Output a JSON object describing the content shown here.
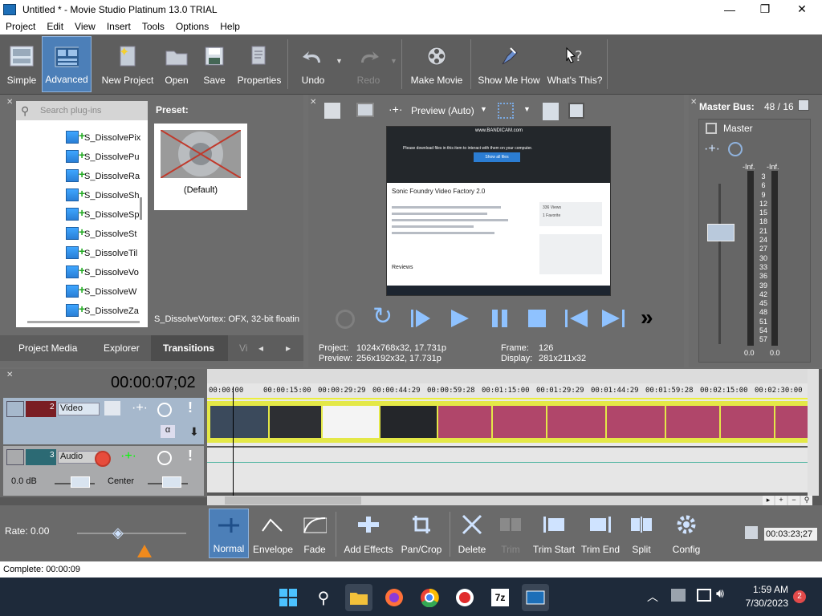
{
  "window": {
    "title": "Untitled * - Movie Studio Platinum 13.0 TRIAL",
    "minimize": "—",
    "maximize": "❐",
    "close": "✕"
  },
  "menu": [
    "Project",
    "Edit",
    "View",
    "Insert",
    "Tools",
    "Options",
    "Help"
  ],
  "toolbar": {
    "simple": "Simple",
    "advanced": "Advanced",
    "new_project": "New Project",
    "open": "Open",
    "save": "Save",
    "properties": "Properties",
    "undo": "Undo",
    "redo": "Redo",
    "make_movie": "Make Movie",
    "show_me_how": "Show Me How",
    "whats_this": "What's This?"
  },
  "plugins": {
    "search_placeholder": "Search plug-ins",
    "items": [
      "S_DissolvePix",
      "S_DissolvePu",
      "S_DissolveRa",
      "S_DissolveSh",
      "S_DissolveSp",
      "S_DissolveSt",
      "S_DissolveTil",
      "S_DissolveVo",
      "S_DissolveW",
      "S_DissolveZa"
    ],
    "selected_index": 7,
    "preset_label": "Preset:",
    "preset_name": "(Default)",
    "description": "S_DissolveVortex: OFX, 32-bit floatin",
    "tabs": [
      "Project Media",
      "Explorer",
      "Transitions",
      "Vi"
    ],
    "active_tab": "Transitions"
  },
  "preview": {
    "mode": "Preview (Auto)",
    "project_label": "Project:",
    "project_value": "1024x768x32, 17.731p",
    "preview_label": "Preview:",
    "preview_value": "256x192x32, 17.731p",
    "frame_label": "Frame:",
    "frame_value": "126",
    "display_label": "Display:",
    "display_value": "281x211x32",
    "screen": {
      "watermark": "www.BANDICAM.com",
      "notice": "Please download files in this item to interact with them on your computer.",
      "show_files": "Show all files",
      "heading": "Sonic Foundry Video Factory 2.0",
      "views": "336 Views",
      "favorites": "1 Favorite",
      "reviews": "Reviews"
    }
  },
  "master": {
    "title": "Master Bus:",
    "value": "48 / 16",
    "label": "Master",
    "peak_left": "-Inf.",
    "peak_right": "-Inf.",
    "scale": [
      "3",
      "6",
      "9",
      "12",
      "15",
      "18",
      "21",
      "24",
      "27",
      "30",
      "33",
      "36",
      "39",
      "42",
      "45",
      "48",
      "51",
      "54",
      "57"
    ],
    "bottom_left": "0.0",
    "bottom_right": "0.0"
  },
  "timeline": {
    "timecode": "00:00:07;02",
    "ruler": [
      "00:00:00",
      "00:00:15:00",
      "00:00:29:29",
      "00:00:44:29",
      "00:00:59:28",
      "00:01:15:00",
      "00:01:29:29",
      "00:01:44:29",
      "00:01:59:28",
      "00:02:15:00",
      "00:02:30:00"
    ],
    "video_track": {
      "number": "2",
      "name": "Video"
    },
    "audio_track": {
      "number": "3",
      "name": "Audio",
      "volume": "0.0 dB",
      "pan": "Center"
    }
  },
  "edit_toolbar": {
    "rate": "Rate: 0.00",
    "normal": "Normal",
    "envelope": "Envelope",
    "fade": "Fade",
    "add_effects": "Add Effects",
    "pan_crop": "Pan/Crop",
    "delete": "Delete",
    "trim": "Trim",
    "trim_start": "Trim Start",
    "trim_end": "Trim End",
    "split": "Split",
    "config": "Config",
    "end_time": "00:03:23;27"
  },
  "status": {
    "complete": "Complete: 00:00:09"
  },
  "taskbar": {
    "time": "1:59 AM",
    "date": "7/30/2023",
    "notifications": "2"
  }
}
